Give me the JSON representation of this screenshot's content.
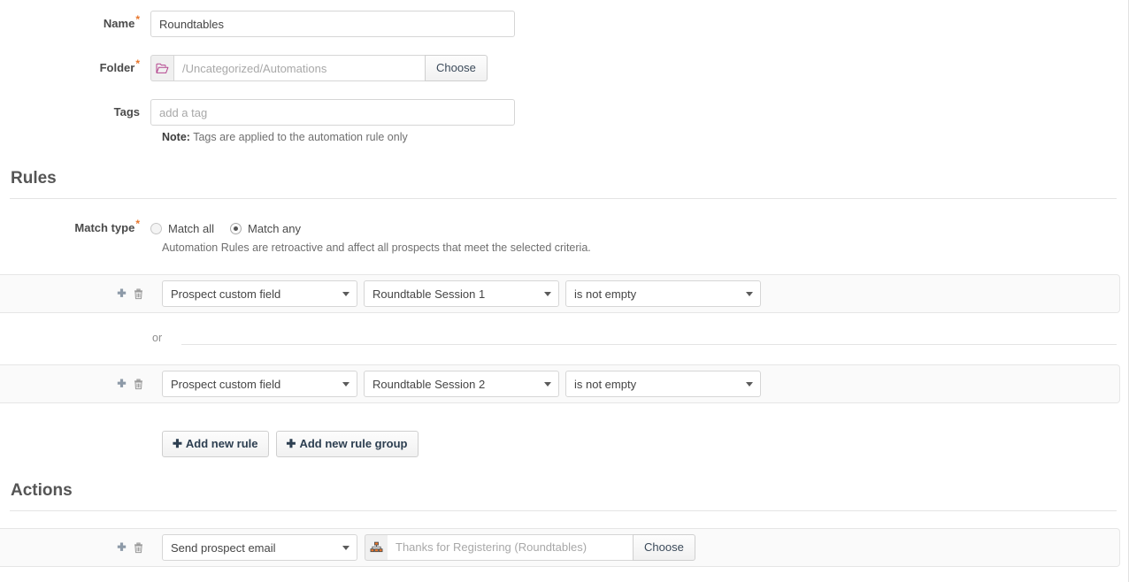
{
  "form": {
    "name": {
      "label": "Name",
      "required": true,
      "value": "Roundtables"
    },
    "folder": {
      "label": "Folder",
      "required": true,
      "placeholder": "/Uncategorized/Automations",
      "icon": "open-folder-icon",
      "choose_label": "Choose"
    },
    "tags": {
      "label": "Tags",
      "required": false,
      "placeholder": "add a tag",
      "note_prefix": "Note:",
      "note_text": "Tags are applied to the automation rule only"
    }
  },
  "rules": {
    "heading": "Rules",
    "match_type": {
      "label": "Match type",
      "required": true,
      "options": [
        {
          "label": "Match all",
          "selected": false
        },
        {
          "label": "Match any",
          "selected": true
        }
      ],
      "description": "Automation Rules are retroactive and affect all prospects that meet the selected criteria."
    },
    "connector": "or",
    "rows": [
      {
        "add_icon": "plus-icon",
        "delete_icon": "trash-icon",
        "field_type": "Prospect custom field",
        "field_name": "Roundtable Session 1",
        "operator": "is not empty"
      },
      {
        "add_icon": "plus-icon",
        "delete_icon": "trash-icon",
        "field_type": "Prospect custom field",
        "field_name": "Roundtable Session 2",
        "operator": "is not empty"
      }
    ],
    "buttons": [
      {
        "plus": "✚",
        "label": "Add new rule"
      },
      {
        "plus": "✚",
        "label": "Add new rule group"
      }
    ]
  },
  "actions": {
    "heading": "Actions",
    "rows": [
      {
        "add_icon": "plus-icon",
        "delete_icon": "trash-icon",
        "action_type": "Send prospect email",
        "asset_icon": "sitemap-icon",
        "asset_placeholder": "Thanks for Registering (Roundtables)",
        "choose_label": "Choose"
      }
    ]
  },
  "colors": {
    "required_asterisk": "#e8762c",
    "panel_background": "#fafafa",
    "border": "#e6e6e6",
    "heading_text": "#555555",
    "folder_icon": "#b4478f",
    "sitemap_icon_accent": "#e8762c",
    "plus_icon": "#8d9aa8",
    "trash_icon": "#9b9b9b"
  }
}
